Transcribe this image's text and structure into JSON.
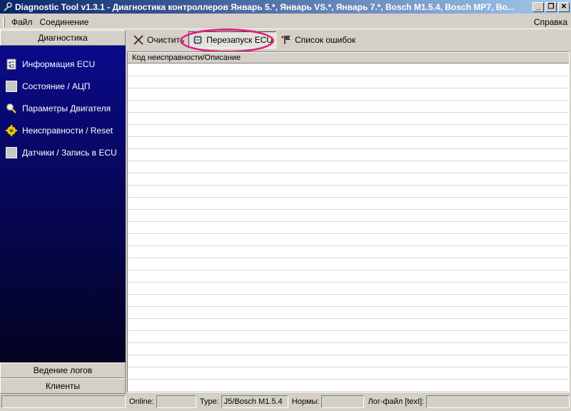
{
  "window": {
    "title": "Diagnostic Tool v1.3.1 - Диагностика контроллеров Январь 5.*, Январь VS.*, Январь 7.*, Bosch M1.5.4, Bosch MP7, Bo...",
    "app_icon": "wrench-icon",
    "controls": {
      "minimize": "_",
      "restore": "❐",
      "close": "✕"
    }
  },
  "menu": {
    "items": [
      "Файл",
      "Соединение"
    ],
    "help": "Справка"
  },
  "sidebar": {
    "header": "Диагностика",
    "items": [
      {
        "label": "Информация ECU",
        "icon": "checklist-icon"
      },
      {
        "label": "Состояние / АЦП",
        "icon": "blank-square-icon"
      },
      {
        "label": "Параметры Двигателя",
        "icon": "magnifier-icon"
      },
      {
        "label": "Неисправности / Reset",
        "icon": "alert-gear-icon"
      },
      {
        "label": "Датчики / Запись в ECU",
        "icon": "blank-square-icon"
      }
    ],
    "footer_logs": "Ведение логов",
    "footer_clients": "Клиенты"
  },
  "toolbar": {
    "clear_label": "Очистить",
    "restart_label": "Перезапуск ECU",
    "errors_label": "Список ошибок"
  },
  "list": {
    "column_header": "Код неисправности/Описание",
    "rows": []
  },
  "status": {
    "online_label": "Online:",
    "online_value": "",
    "type_label": "Type:",
    "type_value": "J5/Bosch M1.5.4",
    "norms_label": "Нормы:",
    "norms_value": "",
    "log_label": "Лог-файл [text]:",
    "log_value": ""
  },
  "colors": {
    "highlight_ring": "#e0207a",
    "titlebar_start": "#0a246a",
    "titlebar_end": "#a6caf0",
    "sidebar_bg": "#0a0a8a"
  }
}
